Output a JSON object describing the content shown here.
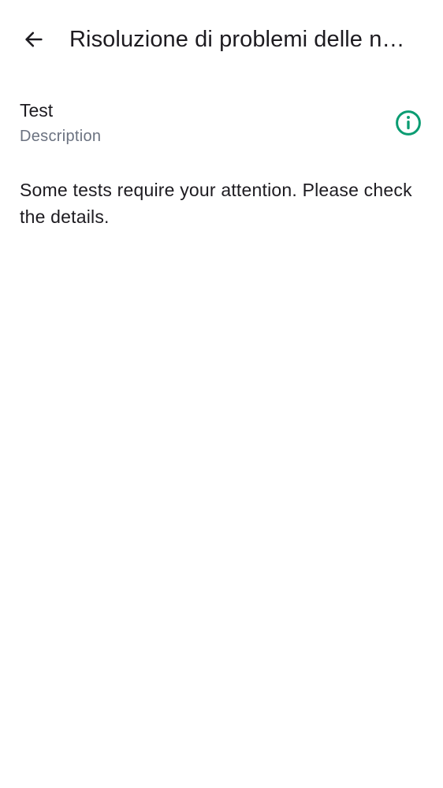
{
  "header": {
    "back_icon": "arrow-back-icon",
    "title": "Risoluzione di problemi delle n…"
  },
  "test_item": {
    "title": "Test",
    "description": "Description",
    "status_icon": "info-icon",
    "status_color": "#0a9c72"
  },
  "message": "Some tests require your attention. Please check the details."
}
